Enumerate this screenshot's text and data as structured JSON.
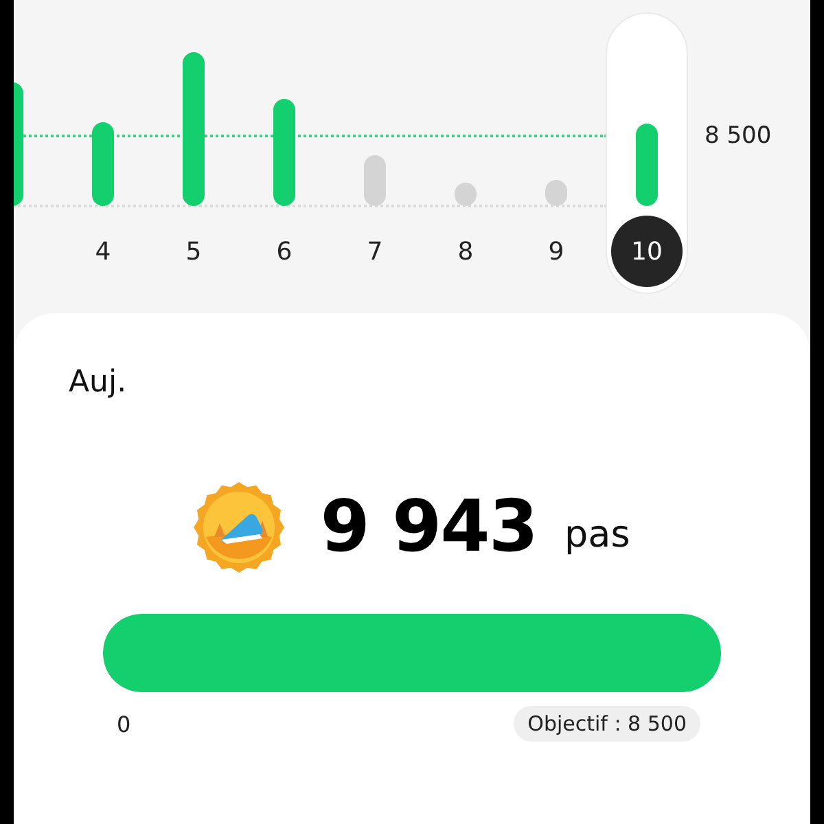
{
  "chart": {
    "goal_label": "8 500",
    "days": [
      {
        "label": "4",
        "reached": true,
        "selected": false
      },
      {
        "label": "5",
        "reached": true,
        "selected": false
      },
      {
        "label": "6",
        "reached": true,
        "selected": false
      },
      {
        "label": "7",
        "reached": false,
        "selected": false
      },
      {
        "label": "8",
        "reached": false,
        "selected": false
      },
      {
        "label": "9",
        "reached": false,
        "selected": false
      },
      {
        "label": "10",
        "reached": true,
        "selected": true
      }
    ]
  },
  "today": {
    "title": "Auj.",
    "steps": "9 943",
    "unit": "pas",
    "progress": {
      "level": 1,
      "start_label": "0",
      "goal_label": "Objectif : 8 500"
    }
  }
}
